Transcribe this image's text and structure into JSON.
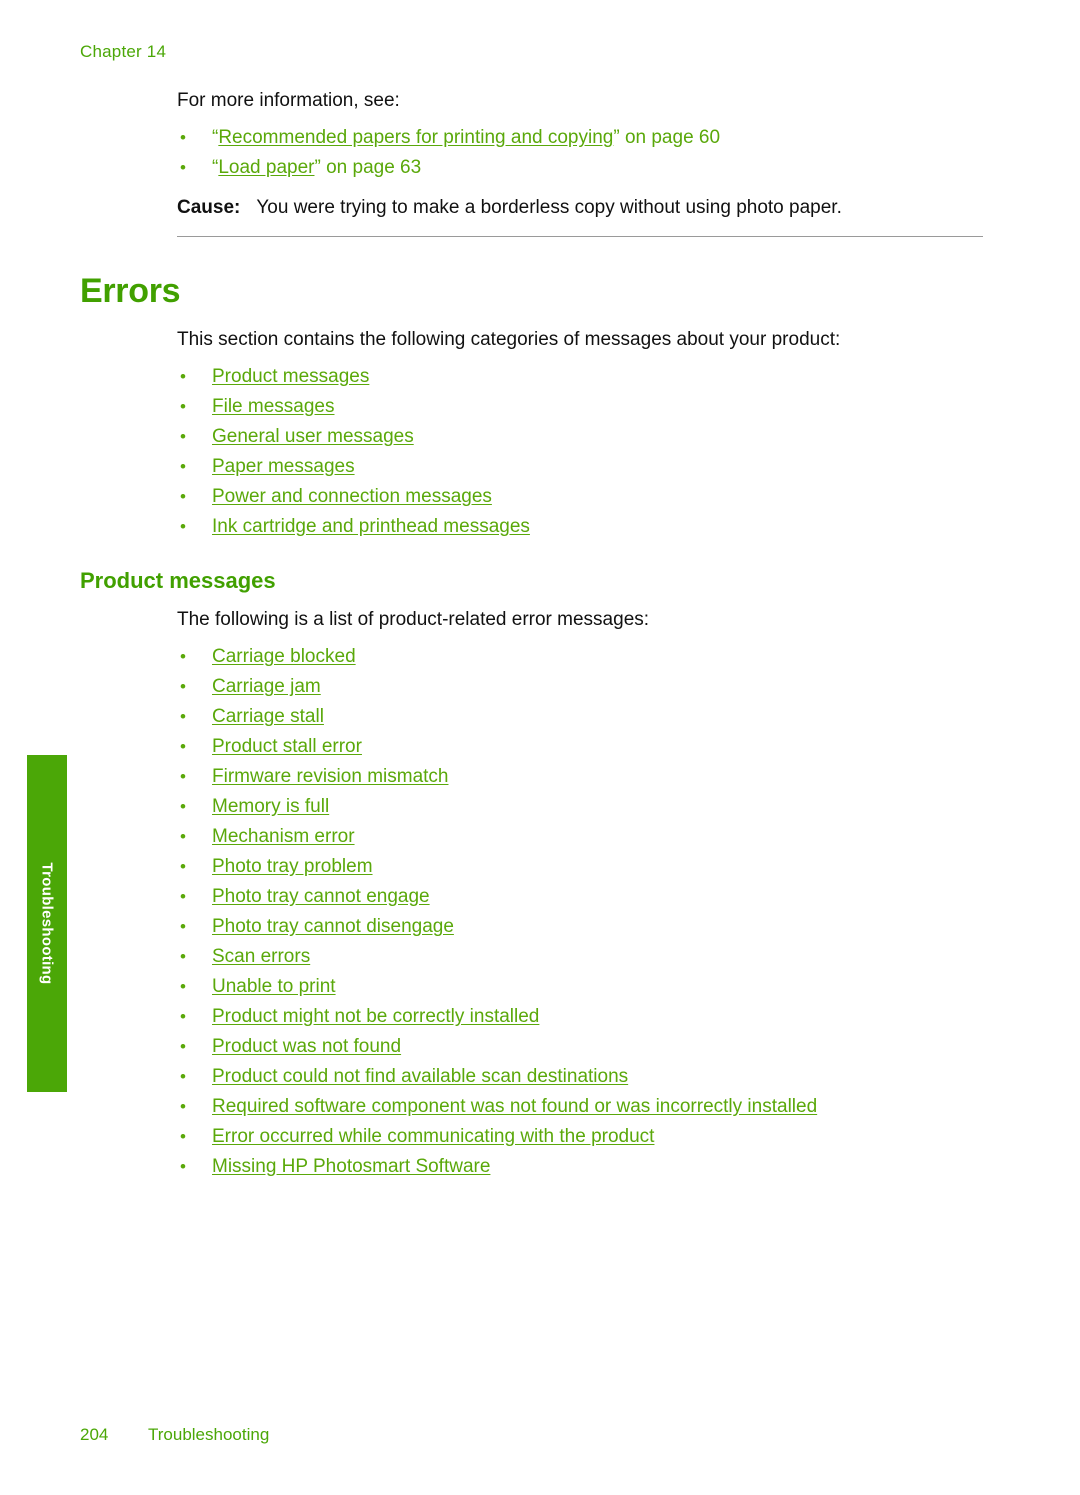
{
  "header": {
    "chapter": "Chapter 14"
  },
  "intro": {
    "lead": "For more information, see:",
    "links": [
      {
        "quote_open": "“",
        "link_text": "Recommended papers for printing and copying",
        "quote_close": "”",
        "suffix": " on page 60"
      },
      {
        "quote_open": "“",
        "link_text": "Load paper",
        "quote_close": "”",
        "suffix": " on page 63"
      }
    ],
    "cause_label": "Cause:",
    "cause_text": "You were trying to make a borderless copy without using photo paper."
  },
  "errors_section": {
    "heading": "Errors",
    "intro": "This section contains the following categories of messages about your product:",
    "categories": [
      "Product messages",
      "File messages",
      "General user messages",
      "Paper messages",
      "Power and connection messages",
      "Ink cartridge and printhead messages"
    ]
  },
  "product_section": {
    "heading": "Product messages",
    "intro": "The following is a list of product-related error messages:",
    "messages": [
      "Carriage blocked",
      "Carriage jam",
      "Carriage stall",
      "Product stall error",
      "Firmware revision mismatch",
      "Memory is full",
      "Mechanism error",
      "Photo tray problem",
      "Photo tray cannot engage",
      "Photo tray cannot disengage",
      "Scan errors",
      "Unable to print",
      "Product might not be correctly installed",
      "Product was not found",
      "Product could not find available scan destinations",
      "Required software component was not found or was incorrectly installed",
      "Error occurred while communicating with the product",
      "Missing HP Photosmart Software"
    ]
  },
  "side_tab": {
    "label": "Troubleshooting"
  },
  "footer": {
    "page_number": "204",
    "section": "Troubleshooting"
  },
  "bullet_glyph": "•",
  "colors": {
    "link_green": "#5aa80a",
    "heading_green": "#41a000",
    "tab_green": "#4ba707",
    "rule_gray": "#9a9a9a",
    "body_black": "#111111"
  }
}
